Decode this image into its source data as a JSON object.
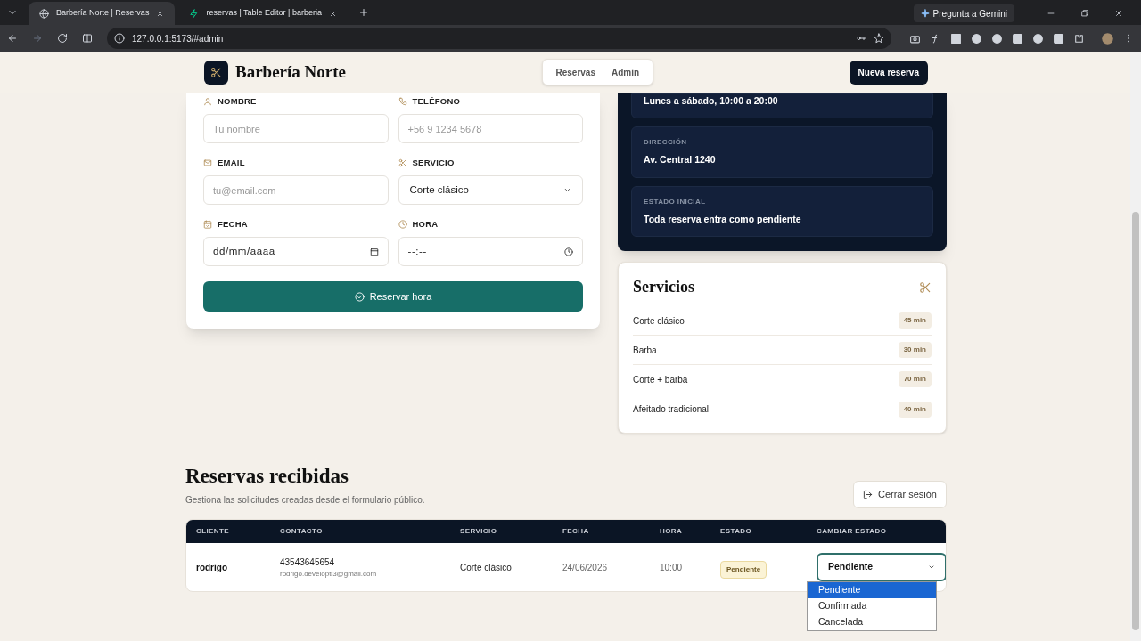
{
  "browser": {
    "tabs": [
      {
        "title": "Barbería Norte | Reservas",
        "selected": true
      },
      {
        "title": "reservas | Table Editor | barberia",
        "selected": false
      }
    ],
    "url": "127.0.0.1:5173/#admin",
    "gemini": "Pregunta a Gemini"
  },
  "header": {
    "brand": "Barbería Norte",
    "nav": [
      {
        "label": "Reservas"
      },
      {
        "label": "Admin"
      }
    ],
    "cta": "Nueva reserva"
  },
  "form": {
    "fields": [
      {
        "kind": "text",
        "label": "NOMBRE",
        "placeholder": "Tu nombre"
      },
      {
        "kind": "text",
        "label": "TELÉFONO",
        "placeholder": "+56 9 1234 5678"
      },
      {
        "kind": "text",
        "label": "EMAIL",
        "placeholder": "tu@email.com"
      },
      {
        "kind": "select",
        "label": "SERVICIO",
        "value": "Corte clásico"
      },
      {
        "kind": "date",
        "label": "FECHA",
        "value": "dd/mm/aaaa"
      },
      {
        "kind": "time",
        "label": "HORA",
        "value": "--:--"
      }
    ],
    "submit": "Reservar hora"
  },
  "info": [
    {
      "value": "Lunes a sábado, 10:00 a 20:00"
    },
    {
      "label": "DIRECCIÓN",
      "value": "Av. Central 1240"
    },
    {
      "label": "ESTADO INICIAL",
      "value": "Toda reserva entra como pendiente"
    }
  ],
  "services": {
    "title": "Servicios",
    "items": [
      {
        "name": "Corte clásico",
        "duration": "45 min"
      },
      {
        "name": "Barba",
        "duration": "30 min"
      },
      {
        "name": "Corte + barba",
        "duration": "70 min"
      },
      {
        "name": "Afeitado tradicional",
        "duration": "40 min"
      }
    ]
  },
  "reservations": {
    "title": "Reservas recibidas",
    "subtitle": "Gestiona las solicitudes creadas desde el formulario público.",
    "logout": "Cerrar sesión",
    "columns": [
      "CLIENTE",
      "CONTACTO",
      "SERVICIO",
      "FECHA",
      "HORA",
      "ESTADO",
      "CAMBIAR ESTADO"
    ],
    "rows": [
      {
        "client": "rodrigo",
        "phone": "43543645654",
        "email": "rodrigo.developti3@gmail.com",
        "service": "Corte clásico",
        "date": "24/06/2026",
        "time": "10:00",
        "status": "Pendiente",
        "status_select": "Pendiente"
      }
    ],
    "dropdown": [
      {
        "label": "Pendiente",
        "selected": true
      },
      {
        "label": "Confirmada",
        "selected": false
      },
      {
        "label": "Cancelada",
        "selected": false
      }
    ]
  }
}
